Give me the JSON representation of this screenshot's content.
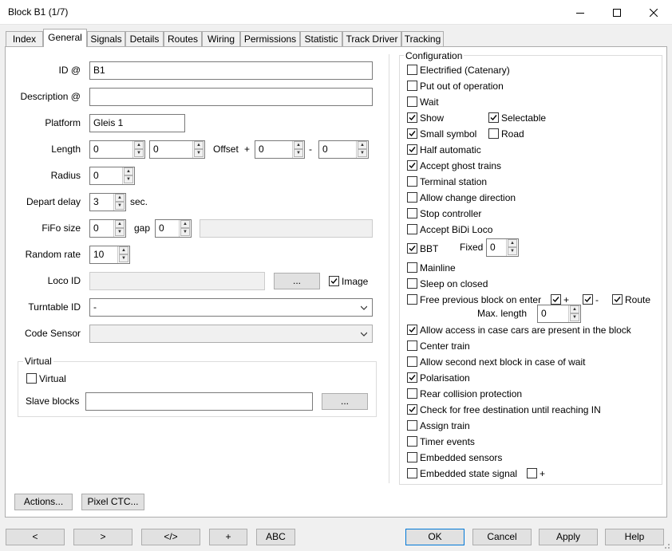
{
  "window": {
    "title": "Block B1 (1/7)"
  },
  "tabs": [
    "Index",
    "General",
    "Signals",
    "Details",
    "Routes",
    "Wiring",
    "Permissions",
    "Statistic",
    "Track Driver",
    "Tracking"
  ],
  "general": {
    "id_label": "ID @",
    "id_value": "B1",
    "description_label": "Description @",
    "description_value": "",
    "platform_label": "Platform",
    "platform_value": "Gleis 1",
    "length_label": "Length",
    "length_value_1": "0",
    "length_value_2": "0",
    "offset_label": "Offset",
    "offset_plus": "+",
    "offset_value_1": "0",
    "offset_minus": "-",
    "offset_value_2": "0",
    "radius_label": "Radius",
    "radius_value": "0",
    "depart_delay_label": "Depart delay",
    "depart_delay_value": "3",
    "depart_delay_unit": "sec.",
    "fifo_label": "FiFo size",
    "fifo_value": "0",
    "gap_label": "gap",
    "gap_value": "0",
    "random_rate_label": "Random rate",
    "random_rate_value": "10",
    "loco_id_label": "Loco ID",
    "loco_id_value": "",
    "loco_browse": "...",
    "image_label": "Image",
    "turntable_label": "Turntable ID",
    "turntable_value": "-",
    "code_sensor_label": "Code Sensor",
    "code_sensor_value": "",
    "virtual_group": "Virtual",
    "virtual_label": "Virtual",
    "slave_blocks_label": "Slave blocks",
    "slave_blocks_value": "",
    "slave_browse": "..."
  },
  "configuration": {
    "title": "Configuration",
    "electrified": "Electrified (Catenary)",
    "out_of_operation": "Put out of operation",
    "wait": "Wait",
    "show": "Show",
    "selectable": "Selectable",
    "small_symbol": "Small symbol",
    "road": "Road",
    "half_automatic": "Half automatic",
    "accept_ghost": "Accept ghost trains",
    "terminal": "Terminal station",
    "allow_change_direction": "Allow change direction",
    "stop_controller": "Stop controller",
    "accept_bidi": "Accept BiDi Loco",
    "bbt": "BBT",
    "fixed_label": "Fixed",
    "fixed_value": "0",
    "mainline": "Mainline",
    "sleep_on_closed": "Sleep on closed",
    "free_previous": "Free previous block on enter",
    "plus": "+",
    "minus": "-",
    "route": "Route",
    "max_length_label": "Max. length",
    "max_length_value": "0",
    "allow_access": "Allow access in case cars are present in the block",
    "center_train": "Center train",
    "allow_second": "Allow second next block in case of wait",
    "polarisation": "Polarisation",
    "rear_collision": "Rear collision protection",
    "check_free_destination": "Check for free destination until reaching IN",
    "assign_train": "Assign train",
    "timer_events": "Timer events",
    "embedded_sensors": "Embedded sensors",
    "embedded_state_signal": "Embedded state signal",
    "state_plus": "+"
  },
  "panel_buttons": {
    "actions": "Actions...",
    "pixel_ctc": "Pixel CTC..."
  },
  "footer": {
    "prev": "<",
    "next": ">",
    "xml": "</>",
    "add": "+",
    "abc": "ABC",
    "ok": "OK",
    "cancel": "Cancel",
    "apply": "Apply",
    "help": "Help"
  },
  "icons": {
    "minimize": "minimize-icon",
    "maximize": "maximize-icon",
    "close": "close-icon",
    "spin": "spin-arrows-icon",
    "dropdown": "chevron-down-icon",
    "check": "checkmark-icon",
    "grip": "resize-grip-icon"
  }
}
